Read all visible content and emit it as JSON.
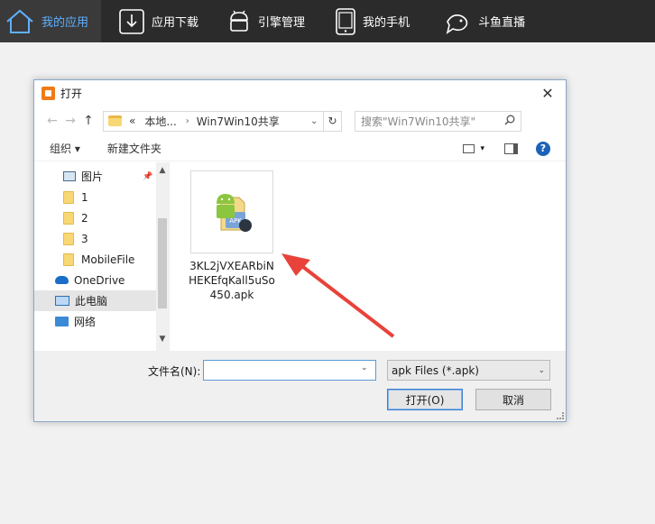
{
  "nav": {
    "items": [
      {
        "label": "我的应用",
        "icon": "home-icon",
        "active": true
      },
      {
        "label": "应用下载",
        "icon": "download-icon",
        "active": false
      },
      {
        "label": "引擎管理",
        "icon": "android-icon",
        "active": false
      },
      {
        "label": "我的手机",
        "icon": "phone-icon",
        "active": false
      },
      {
        "label": "斗鱼直播",
        "icon": "fish-icon",
        "active": false
      }
    ],
    "active_color": "#5fb0ff"
  },
  "dialog": {
    "title": "打开",
    "close": "✕",
    "address": {
      "back": "←",
      "forward": "→",
      "up": "↑",
      "prefix": "«",
      "seg1": "本地...",
      "sep": "›",
      "seg2": "Win7Win10共享",
      "dropdown": "⌄",
      "refresh": "↻"
    },
    "search_placeholder": "搜索\"Win7Win10共享\"",
    "toolbar": {
      "organize": "组织 ▾",
      "new_folder": "新建文件夹",
      "help": "?"
    },
    "nav_pane": [
      {
        "label": "图片",
        "icon": "pictures-icon",
        "pinned": true
      },
      {
        "label": "1",
        "icon": "folder-icon"
      },
      {
        "label": "2",
        "icon": "folder-icon"
      },
      {
        "label": "3",
        "icon": "folder-icon"
      },
      {
        "label": "MobileFile",
        "icon": "folder-icon"
      },
      {
        "label": "OneDrive",
        "icon": "onedrive-icon"
      },
      {
        "label": "此电脑",
        "icon": "this-pc-icon",
        "selected": true
      },
      {
        "label": "网络",
        "icon": "network-icon"
      }
    ],
    "file": {
      "name": "3KL2jVXEARbiNHEKEfqKall5uSo450.apk",
      "icon": "apk-file-icon",
      "badge": "APK"
    },
    "bottom": {
      "filename_label": "文件名(N):",
      "filename_value": "",
      "filetype": "apk Files (*.apk)",
      "open_label": "打开(O)",
      "cancel_label": "取消"
    }
  },
  "annotation": {
    "arrow_color": "#e8423a"
  }
}
